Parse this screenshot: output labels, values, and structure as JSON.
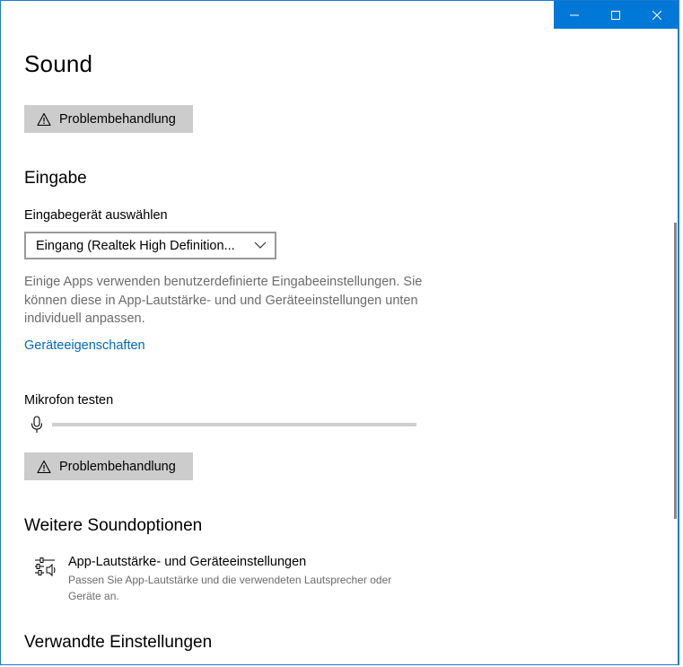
{
  "window": {
    "controls": {
      "minimize": "minimize-icon",
      "maximize": "maximize-icon",
      "close": "close-icon"
    }
  },
  "page": {
    "title": "Sound"
  },
  "top_button": {
    "label": "Problembehandlung",
    "icon": "warning-icon"
  },
  "input_section": {
    "title": "Eingabe",
    "device_label": "Eingabegerät auswählen",
    "device_selected": "Eingang (Realtek High Definition...",
    "description": "Einige Apps verwenden benutzerdefinierte Eingabeeinstellungen. Sie können diese in App-Lautstärke- und und Geräteeinstellungen unten individuell anpassen.",
    "properties_link": "Geräteeigenschaften",
    "mic_test_label": "Mikrofon testen",
    "mic_level": 0,
    "troubleshoot_label": "Problembehandlung"
  },
  "more_options": {
    "title": "Weitere Soundoptionen",
    "item_title": "App-Lautstärke- und Geräteeinstellungen",
    "item_desc": "Passen Sie App-Lautstärke und die verwendeten Lautsprecher oder Geräte an."
  },
  "related": {
    "title": "Verwandte Einstellungen"
  },
  "colors": {
    "accent": "#0078d7",
    "link": "#0067c0",
    "button_bg": "#cccccc",
    "muted_text": "#6b6b6b"
  }
}
